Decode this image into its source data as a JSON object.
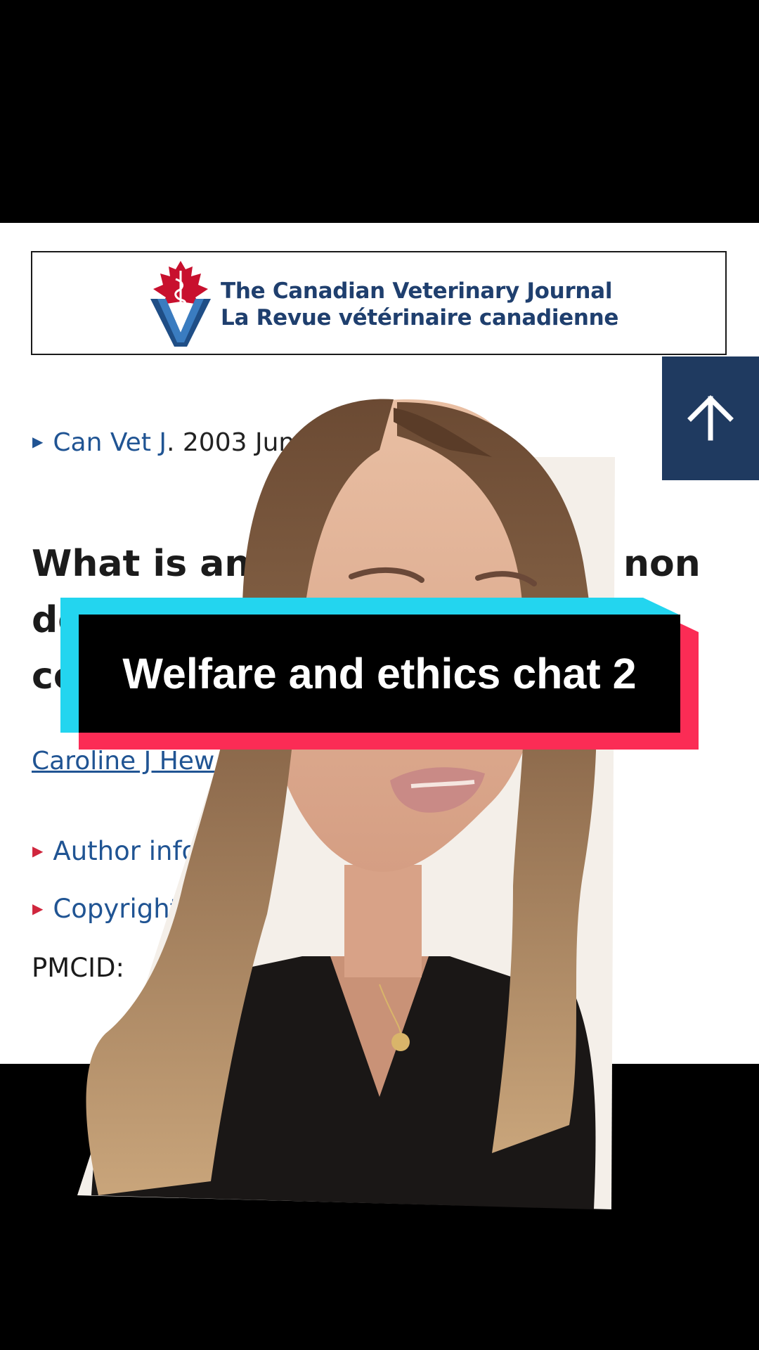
{
  "journal": {
    "name_en": "The Canadian Veterinary Journal",
    "name_fr": "La Revue vétérinaire canadienne"
  },
  "citation": {
    "journal_abbrev": "Can Vet J",
    "date_volume": ". 2003 Jun;44(6"
  },
  "article": {
    "title_line1": "What is anim",
    "title_line1_end": "non",
    "title_line2": "de",
    "title_line3": "co"
  },
  "author": {
    "name": "Caroline J Hew"
  },
  "sections": {
    "author_info": "Author info",
    "copyright": "Copyright"
  },
  "pmcid": {
    "label": "PMCID:"
  },
  "overlay": {
    "caption": "Welfare and ethics chat 2"
  },
  "colors": {
    "journal_navy": "#1f3f6e",
    "link_blue": "#205493",
    "scroll_button": "#1f3a60",
    "caption_cyan": "#23d5ef",
    "caption_red": "#fb2c55",
    "maple_red": "#c8102e"
  },
  "icons": {
    "scroll_top": "arrow-up-icon",
    "logo": "maple-leaf-caduceus-logo"
  }
}
